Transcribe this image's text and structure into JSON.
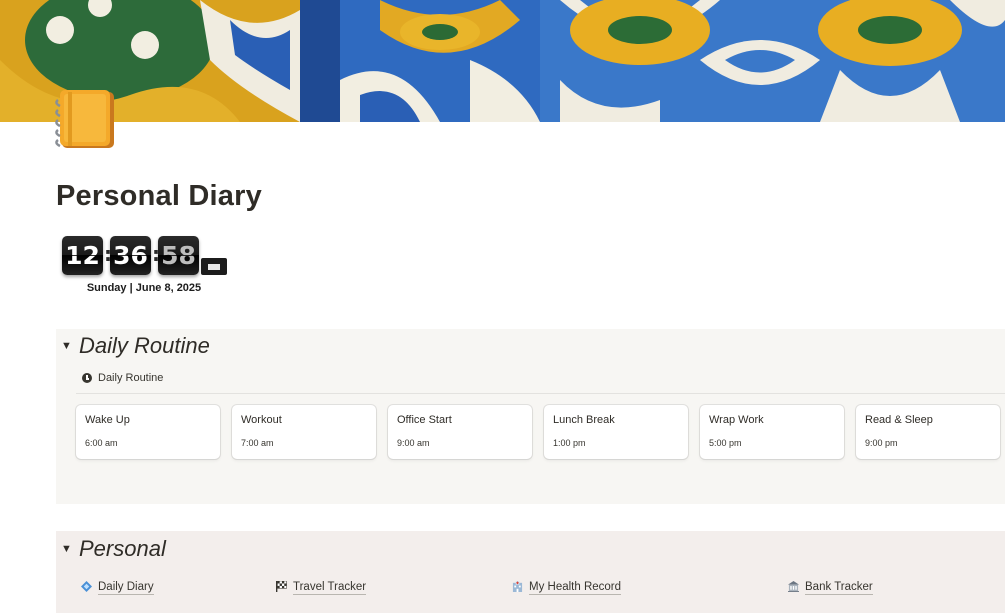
{
  "page": {
    "title": "Personal Diary"
  },
  "clock": {
    "hours": "12",
    "minutes": "36",
    "seconds": "58",
    "separator": ":",
    "date": "Sunday | June 8, 2025"
  },
  "routine": {
    "heading": "Daily Routine",
    "view_title": "Daily Routine",
    "items": [
      {
        "name": "Wake Up",
        "time": "6:00 am"
      },
      {
        "name": "Workout",
        "time": "7:00 am"
      },
      {
        "name": "Office Start",
        "time": "9:00 am"
      },
      {
        "name": "Lunch Break",
        "time": "1:00 pm"
      },
      {
        "name": "Wrap Work",
        "time": "5:00 pm"
      },
      {
        "name": "Read & Sleep",
        "time": "9:00 pm"
      }
    ]
  },
  "personal": {
    "heading": "Personal",
    "links": [
      {
        "label": "Daily Diary",
        "icon": "diamond-icon"
      },
      {
        "label": "Travel Tracker",
        "icon": "checkered-flag-icon"
      },
      {
        "label": "My Health Record",
        "icon": "hospital-icon"
      },
      {
        "label": "Bank Tracker",
        "icon": "bank-icon"
      }
    ]
  },
  "colors": {
    "routine_bg": "#f7f6f3",
    "personal_bg": "#f3eeec",
    "text": "#37352f"
  }
}
